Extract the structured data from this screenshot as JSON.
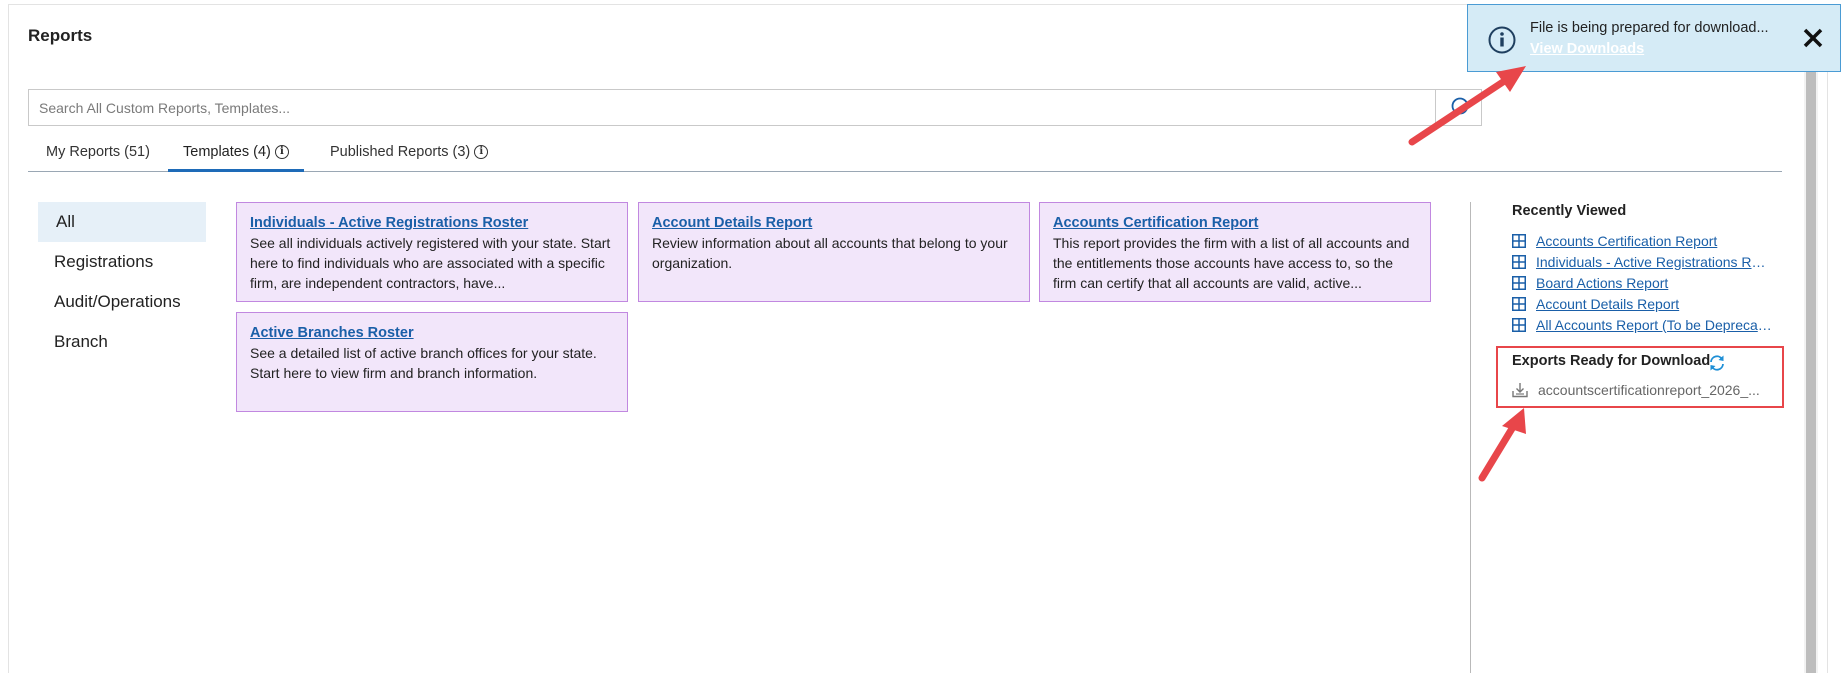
{
  "page": {
    "title": "Reports"
  },
  "search": {
    "placeholder": "Search All Custom Reports, Templates..."
  },
  "tabs": [
    {
      "label": "My Reports (51)",
      "active": false,
      "info": false
    },
    {
      "label": "Templates (4)",
      "active": true,
      "info": true
    },
    {
      "label": "Published Reports (3)",
      "active": false,
      "info": true
    }
  ],
  "categories": [
    {
      "label": "All",
      "active": true
    },
    {
      "label": "Registrations",
      "active": false
    },
    {
      "label": "Audit/Operations",
      "active": false
    },
    {
      "label": "Branch",
      "active": false
    }
  ],
  "templates": [
    {
      "title": "Individuals - Active Registrations Roster",
      "description": "See all individuals actively registered with your state. Start here to find individuals who are associated with a specific firm, are independent contractors, have..."
    },
    {
      "title": "Account Details Report",
      "description": "Review information about all accounts that belong to your organization."
    },
    {
      "title": "Accounts Certification Report",
      "description": "This report provides the firm with a list of all accounts and the entitlements those accounts have access to, so the firm can certify that all accounts are valid, active..."
    },
    {
      "title": "Active Branches Roster",
      "description": "See a detailed list of active branch offices for your state. Start here to view firm and branch information."
    }
  ],
  "recently_viewed": {
    "title": "Recently Viewed",
    "items": [
      "Accounts Certification Report",
      "Individuals - Active Registrations Roster",
      "Board Actions Report",
      "Account Details Report",
      "All Accounts Report (To be Deprecated)"
    ]
  },
  "exports": {
    "title": "Exports Ready for Download",
    "items": [
      "accountscertificationreport_2026_..."
    ]
  },
  "toast": {
    "message": "File is being prepared for download...",
    "link": "View Downloads"
  },
  "colors": {
    "accent": "#1e6bb8",
    "link": "#1a5fa8",
    "card_bg": "#f2e6fa",
    "card_border": "#c188e0",
    "toast_bg": "#d5ebf6",
    "annotation": "#e8464a"
  }
}
